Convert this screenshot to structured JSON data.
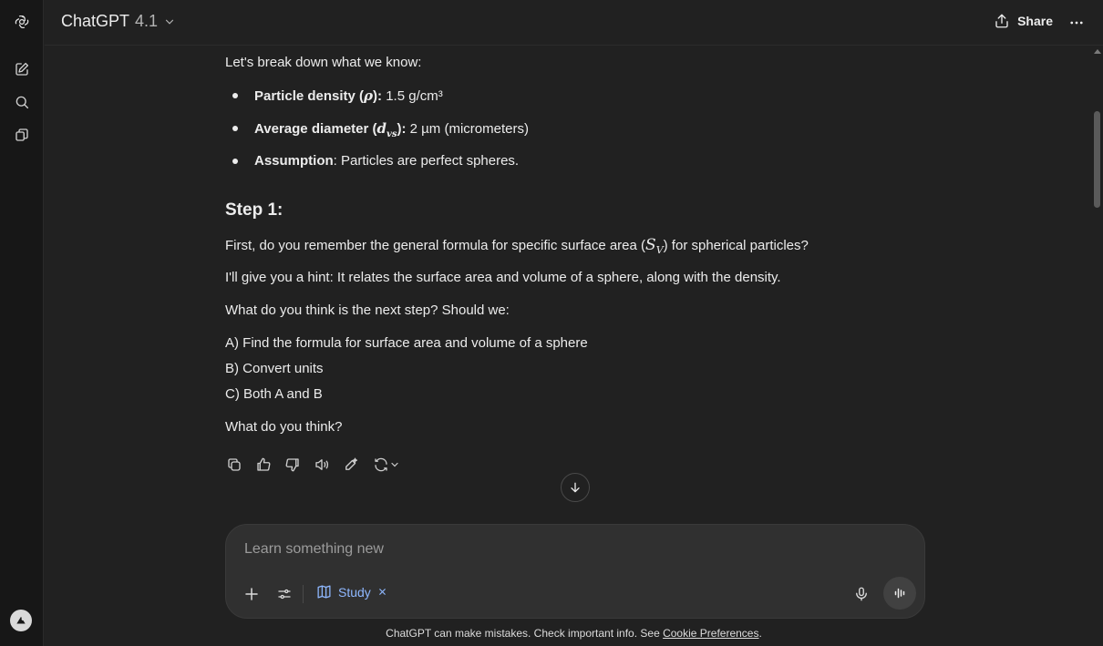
{
  "colors": {
    "background": "#212121",
    "sidebar": "#171717",
    "accent": "#8fb8ff",
    "text": "#ececec"
  },
  "sidebar": {
    "icons": [
      "openai-logo-icon",
      "new-chat-icon",
      "search-icon",
      "library-icon"
    ],
    "avatar_icon": "avatar-icon"
  },
  "header": {
    "model_name": "ChatGPT",
    "model_version": "4.1",
    "share_label": "Share"
  },
  "message": {
    "intro": "Let's break down what we know:",
    "bullets": [
      {
        "label": "Particle density (",
        "symbol": "ρ",
        "after": "): ",
        "value": "1.5 g/cm³"
      },
      {
        "label": "Average diameter (",
        "symbol": "d",
        "subscript": "vs",
        "after": "): ",
        "value": "2 µm (micrometers)"
      },
      {
        "label": "Assumption",
        "after": ": ",
        "value": "Particles are perfect spheres."
      }
    ],
    "step_heading": "Step 1:",
    "p1_before": "First, do you remember the general formula for specific surface area (",
    "p1_symbol": "S",
    "p1_subscript": "V",
    "p1_after": ") for spherical particles?",
    "p2": "I'll give you a hint: It relates the surface area and volume of a sphere, along with the density.",
    "p3": "What do you think is the next step? Should we:",
    "options": [
      "A) Find the formula for surface area and volume of a sphere",
      "B) Convert units",
      "C) Both A and B"
    ],
    "closing": "What do you think?"
  },
  "composer": {
    "placeholder": "Learn something new",
    "tool_label": "Study"
  },
  "footer": {
    "text": "ChatGPT can make mistakes. Check important info. See ",
    "link": "Cookie Preferences",
    "end": "."
  }
}
